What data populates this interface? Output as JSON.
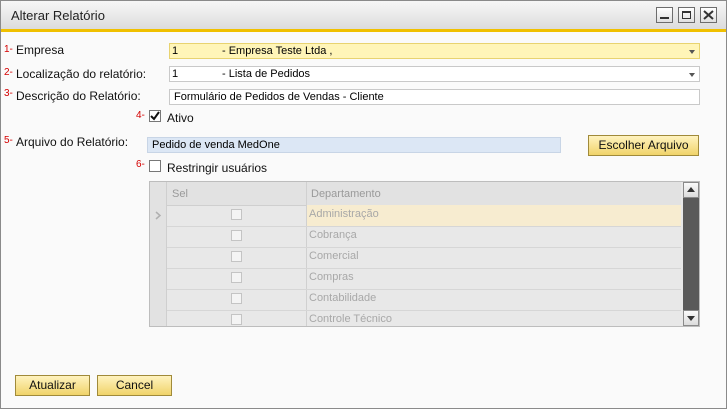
{
  "window": {
    "title": "Alterar Relatório",
    "controls": {
      "minimize": "minimize-icon",
      "maximize": "maximize-icon",
      "close": "close-icon"
    }
  },
  "form": {
    "empresa": {
      "number": "1-",
      "label": "Empresa",
      "code": "1",
      "value": "- Empresa Teste Ltda ,"
    },
    "localizacao": {
      "number": "2-",
      "label": "Localização do relatório:",
      "code": "1",
      "value": "- Lista de Pedidos"
    },
    "descricao": {
      "number": "3-",
      "label": "Descrição do Relatório:",
      "value": "Formulário de Pedidos de Vendas - Cliente"
    },
    "ativo": {
      "number": "4-",
      "label": "Ativo",
      "checked": true
    },
    "arquivo": {
      "number": "5-",
      "label": "Arquivo do Relatório:",
      "value": "Pedido de venda MedOne",
      "button": "Escolher Arquivo"
    },
    "restringir": {
      "number": "6-",
      "label": "Restringir usuários",
      "checked": false
    }
  },
  "grid": {
    "columns": [
      "Sel",
      "Departamento"
    ],
    "rows": [
      {
        "departamento": "Administração",
        "selected": true
      },
      {
        "departamento": "Cobrança"
      },
      {
        "departamento": "Comercial"
      },
      {
        "departamento": "Compras"
      },
      {
        "departamento": "Contabilidade"
      },
      {
        "departamento": "Controle Técnico"
      }
    ]
  },
  "footer": {
    "atualizar": "Atualizar",
    "cancel": "Cancel"
  },
  "colors": {
    "accent": "#f0c000",
    "field_highlight": "#fff5b8",
    "required": "#d40000"
  }
}
